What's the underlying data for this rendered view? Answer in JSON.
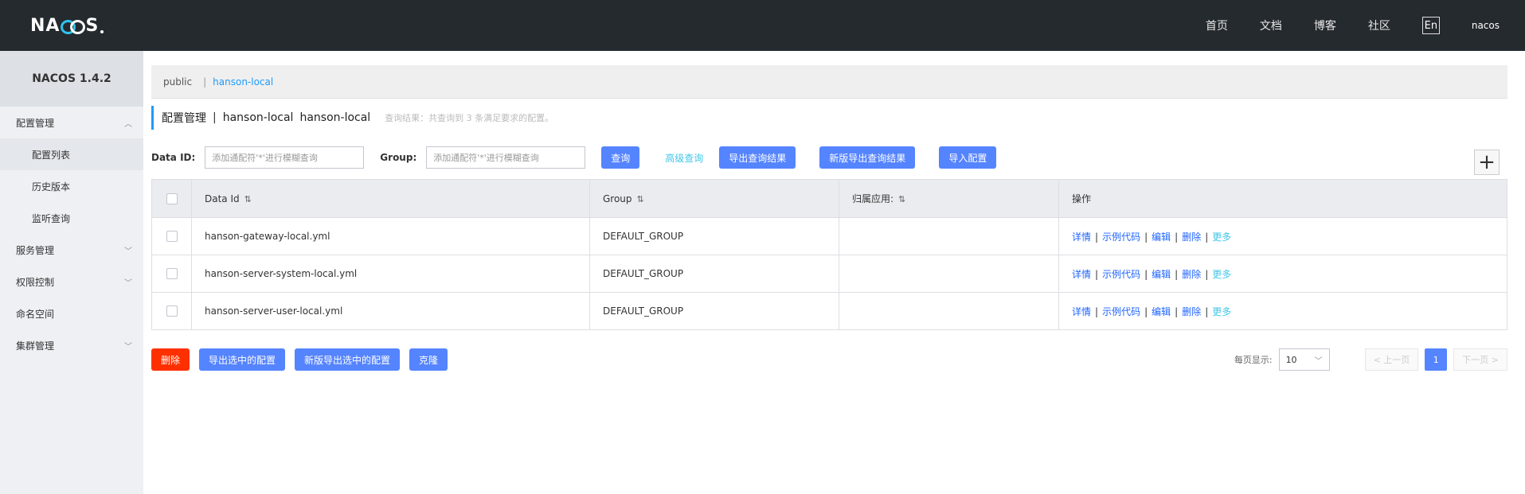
{
  "header": {
    "logo_text": "NACOS",
    "nav": [
      "首页",
      "文档",
      "博客",
      "社区"
    ],
    "lang": "En",
    "user": "nacos"
  },
  "sidebar": {
    "title": "NACOS 1.4.2",
    "groups": [
      {
        "label": "配置管理",
        "icon": "chevron-up-icon"
      },
      {
        "label": "服务管理",
        "icon": "chevron-down-icon"
      },
      {
        "label": "权限控制",
        "icon": "chevron-down-icon"
      },
      {
        "label": "命名空间",
        "icon": ""
      },
      {
        "label": "集群管理",
        "icon": "chevron-down-icon"
      }
    ],
    "config_items": [
      "配置列表",
      "历史版本",
      "监听查询"
    ]
  },
  "namespace": {
    "public": "public",
    "separator": "|",
    "active": "hanson-local"
  },
  "page_title": {
    "main": "配置管理",
    "sep": "|",
    "namespace_a": "hanson-local",
    "namespace_b": "hanson-local",
    "hint": "查询结果：共查询到 3 条满足要求的配置。"
  },
  "search": {
    "data_id_label": "Data ID:",
    "data_id_placeholder": "添加通配符'*'进行模糊查询",
    "group_label": "Group:",
    "group_placeholder": "添加通配符'*'进行模糊查询",
    "query_btn": "查询",
    "advanced_btn": "高级查询",
    "export_btn": "导出查询结果",
    "new_export_btn": "新版导出查询结果",
    "import_btn": "导入配置",
    "add_symbol": "+"
  },
  "table": {
    "headers": [
      "Data Id",
      "Group",
      "归属应用:",
      "操作"
    ],
    "sort_icon": "⇅",
    "rows": [
      {
        "data_id": "hanson-gateway-local.yml",
        "group": "DEFAULT_GROUP",
        "app": ""
      },
      {
        "data_id": "hanson-server-system-local.yml",
        "group": "DEFAULT_GROUP",
        "app": ""
      },
      {
        "data_id": "hanson-server-user-local.yml",
        "group": "DEFAULT_GROUP",
        "app": ""
      }
    ],
    "ops": [
      "详情",
      "示例代码",
      "编辑",
      "删除",
      "更多"
    ]
  },
  "bottom": {
    "delete_btn": "删除",
    "export_selected_btn": "导出选中的配置",
    "new_export_selected_btn": "新版导出选中的配置",
    "clone_btn": "克隆"
  },
  "pagination": {
    "page_size_label": "每页显示:",
    "page_size": "10",
    "prev": "< 上一页",
    "current": "1",
    "next": "下一页 >"
  },
  "colors": {
    "topbar": "#252a2f",
    "primary": "#5584ff",
    "danger": "#ff3000",
    "link": "#1f64ff",
    "accent": "#40c6e8"
  }
}
